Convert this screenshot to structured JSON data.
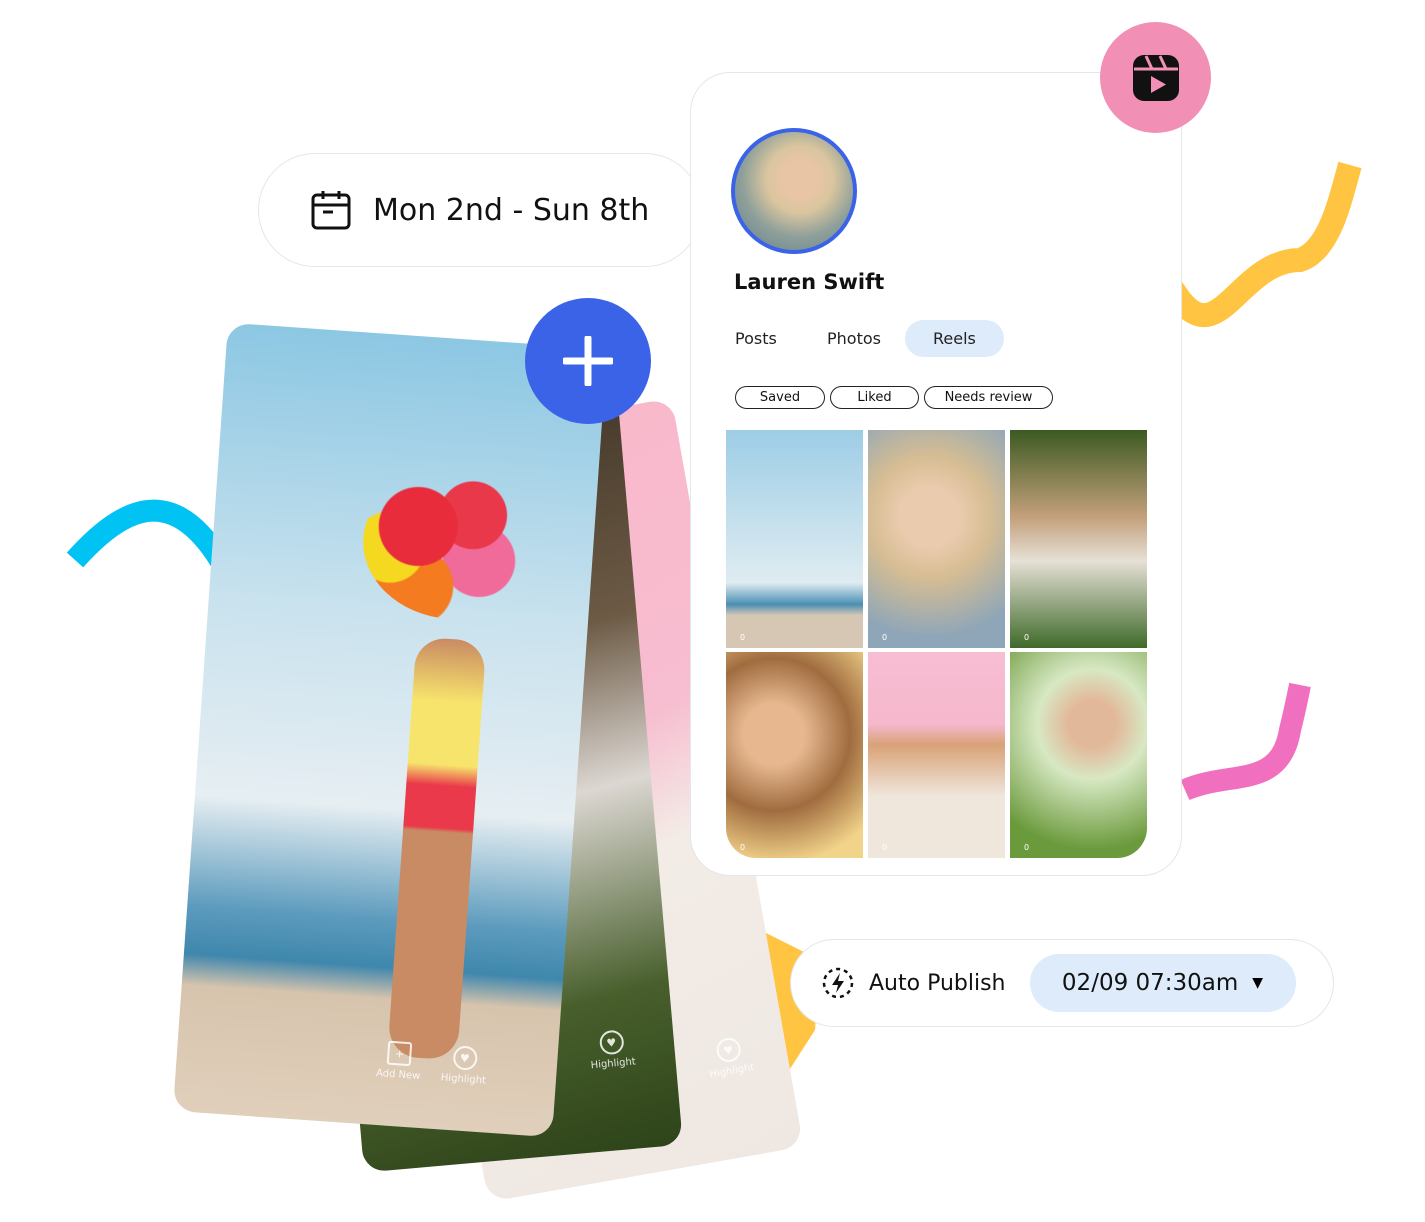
{
  "date_range": {
    "label": "Mon 2nd - Sun 8th",
    "icon": "calendar-icon"
  },
  "profile": {
    "name": "Lauren Swift",
    "tabs": [
      "Posts",
      "Photos",
      "Reels"
    ],
    "active_tab": "Reels",
    "filters": [
      "Saved",
      "Liked",
      "Needs review"
    ],
    "grid_views": [
      "0",
      "0",
      "0",
      "0",
      "0",
      "0"
    ]
  },
  "story_actions": [
    {
      "label": "Add New",
      "icon": "add-copy-icon"
    },
    {
      "label": "Highlight",
      "icon": "heart-icon"
    },
    {
      "label": "Highlight",
      "icon": "heart-icon"
    },
    {
      "label": "Highlight",
      "icon": "heart-icon"
    }
  ],
  "auto_publish": {
    "label": "Auto Publish",
    "icon": "lightning-icon",
    "datetime": "02/09 07:30am"
  },
  "colors": {
    "accent_blue": "#3a63e8",
    "pink": "#f28fb5",
    "yellow": "#ffc542",
    "cyan": "#00c2f3",
    "magenta": "#f06fbf",
    "tab_bg": "#deebfb"
  }
}
